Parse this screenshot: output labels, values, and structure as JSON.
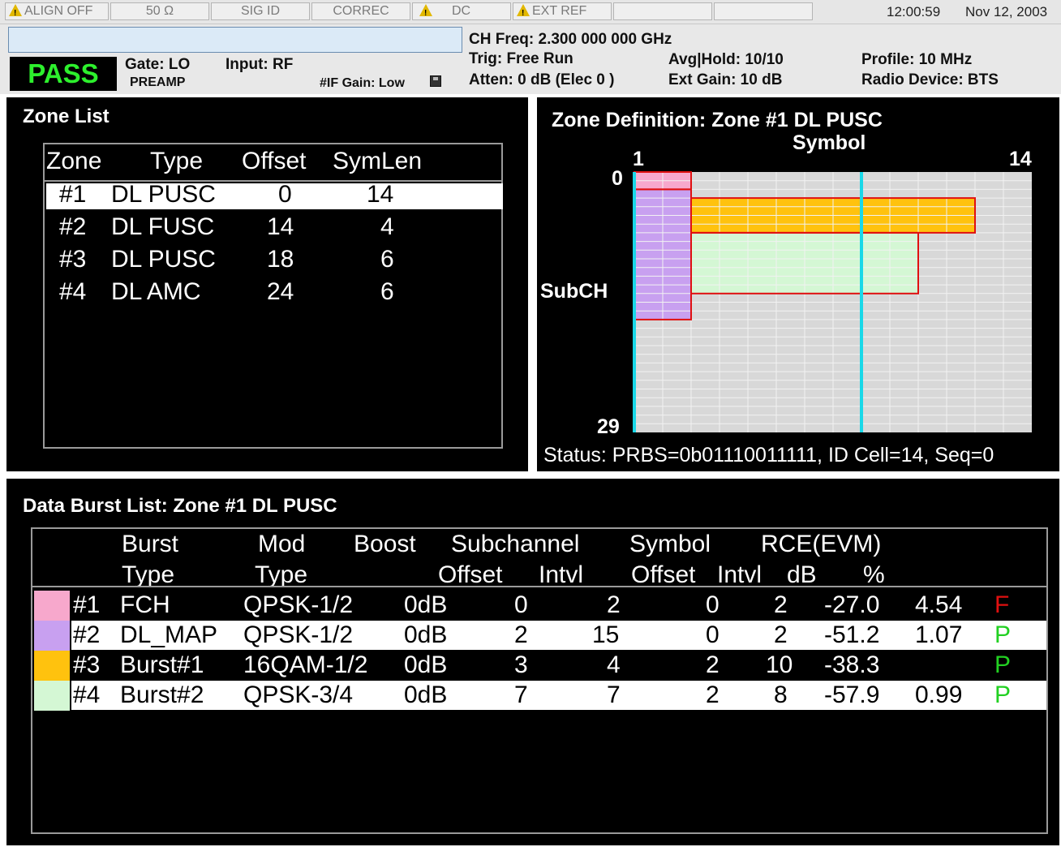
{
  "statusbar": {
    "align": "ALIGN OFF",
    "impedance": "50 Ω",
    "sig_id": "SIG ID",
    "correc": "CORREC",
    "dc": "DC",
    "ext_ref": "EXT REF",
    "time": "12:00:59",
    "date": "Nov 12, 2003",
    "warn_color": "#e2b800"
  },
  "header": {
    "pass": "PASS",
    "gate": "Gate: LO",
    "preamp": "PREAMP",
    "input": "Input: RF",
    "if_gain": "#IF Gain: Low",
    "ch_freq": "CH Freq: 2.300 000 000 GHz",
    "trig": "Trig:  Free Run",
    "atten": "Atten:   0 dB (Elec 0 )",
    "avg_hold": "Avg|Hold: 10/10",
    "ext_gain": "Ext Gain: 10 dB",
    "profile": "Profile: 10 MHz",
    "radio_device": "Radio Device: BTS",
    "pass_color": "#2df02d"
  },
  "zone_list": {
    "title": "Zone List",
    "columns": [
      "Zone",
      "Type",
      "Offset",
      "SymLen"
    ],
    "rows": [
      {
        "zone": "#1",
        "type": "DL PUSC",
        "offset": "0",
        "symlen": "14"
      },
      {
        "zone": "#2",
        "type": "DL FUSC",
        "offset": "14",
        "symlen": "4"
      },
      {
        "zone": "#3",
        "type": "DL PUSC",
        "offset": "18",
        "symlen": "6"
      },
      {
        "zone": "#4",
        "type": "DL AMC",
        "offset": "24",
        "symlen": "6"
      }
    ]
  },
  "zone_def": {
    "title": "Zone Definition: Zone #1 DL PUSC",
    "x_label": "Symbol",
    "y_label": "SubCH",
    "x_start": "1",
    "x_end": "14",
    "y_start": "0",
    "y_end": "29",
    "status": "Status: PRBS=0b01110011111, ID Cell=14, Seq=0"
  },
  "burst_list": {
    "title": "Data Burst List: Zone #1 DL PUSC",
    "headers": {
      "burst": "Burst",
      "burst_type": "Type",
      "mod": "Mod",
      "mod_type": "Type",
      "boost": "Boost",
      "subchannel": "Subchannel",
      "sub_offset": "Offset",
      "sub_intvl": "Intvl",
      "symbol": "Symbol",
      "sym_offset": "Offset",
      "sym_intvl": "Intvl",
      "rce": "RCE(EVM)",
      "db": "dB",
      "pct": "%"
    },
    "rows": [
      {
        "id": "#1",
        "type": "FCH",
        "mod": "QPSK-1/2",
        "boost": "0dB",
        "sub_off": "0",
        "sub_int": "2",
        "sym_off": "0",
        "sym_int": "2",
        "db": "-27.0",
        "pct": "4.54",
        "pf": "F",
        "color": "#f7a8cc"
      },
      {
        "id": "#2",
        "type": "DL_MAP",
        "mod": "QPSK-1/2",
        "boost": "0dB",
        "sub_off": "2",
        "sub_int": "15",
        "sym_off": "0",
        "sym_int": "2",
        "db": "-51.2",
        "pct": "1.07",
        "pf": "P",
        "color": "#c8a0f0"
      },
      {
        "id": "#3",
        "type": "Burst#1",
        "mod": "16QAM-1/2",
        "boost": "0dB",
        "sub_off": "3",
        "sub_int": "4",
        "sym_off": "2",
        "sym_int": "10",
        "db": "-38.3",
        "pct": "",
        "pf": "P",
        "color": "#ffc20e"
      },
      {
        "id": "#4",
        "type": "Burst#2",
        "mod": "QPSK-3/4",
        "boost": "0dB",
        "sub_off": "7",
        "sub_int": "7",
        "sym_off": "2",
        "sym_int": "8",
        "db": "-57.9",
        "pct": "0.99",
        "pf": "P",
        "color": "#d4f7d4"
      }
    ]
  }
}
